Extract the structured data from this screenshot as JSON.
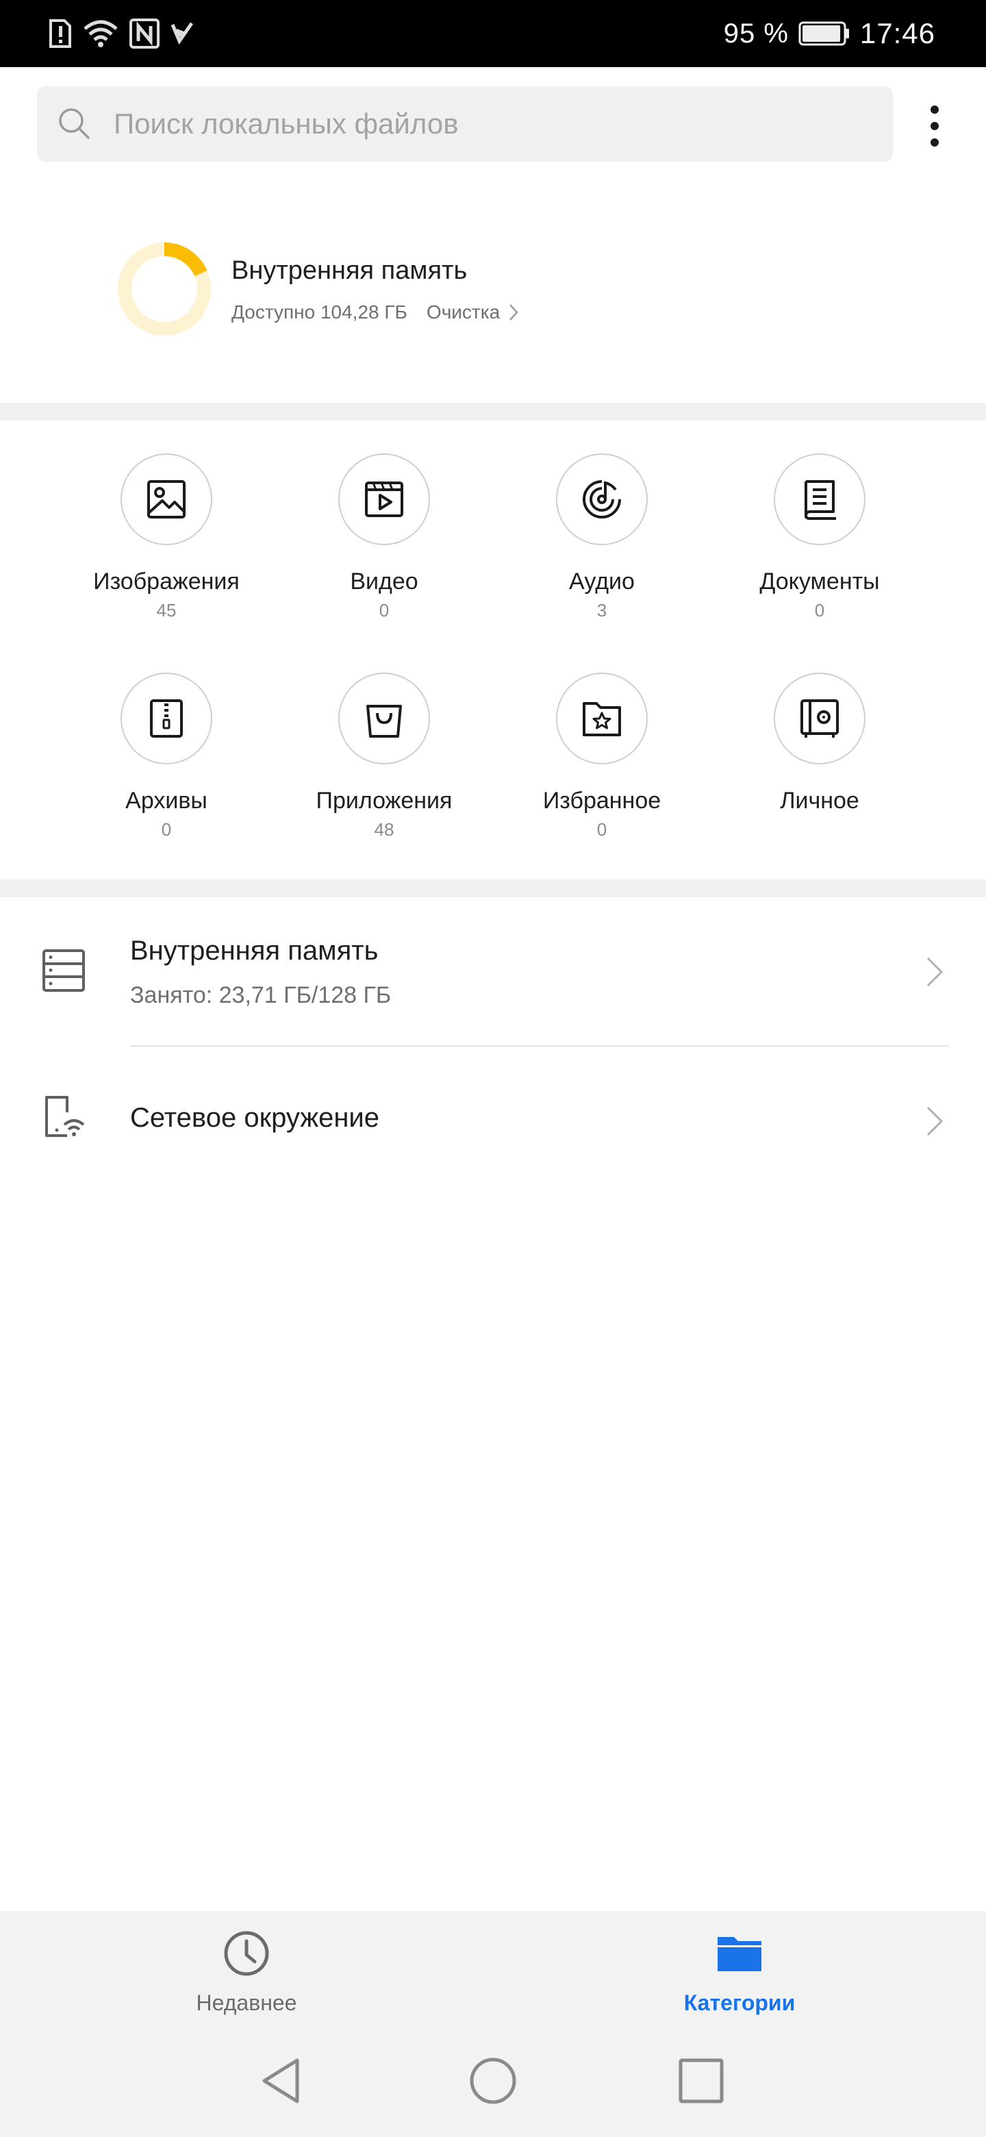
{
  "status_bar": {
    "battery_percent": "95 %",
    "time": "17:46",
    "battery_level": 0.95
  },
  "search": {
    "placeholder": "Поиск локальных файлов"
  },
  "storage_summary": {
    "title": "Внутренняя память",
    "available_text": "Доступно 104,28 ГБ",
    "clean_label": "Очистка",
    "used_fraction": 0.185,
    "accent_color": "#FBBC05",
    "track_color": "#FDF3D3"
  },
  "categories": [
    {
      "label": "Изображения",
      "count": "45",
      "icon": "image-icon"
    },
    {
      "label": "Видео",
      "count": "0",
      "icon": "video-icon"
    },
    {
      "label": "Аудио",
      "count": "3",
      "icon": "audio-icon"
    },
    {
      "label": "Документы",
      "count": "0",
      "icon": "document-icon"
    },
    {
      "label": "Архивы",
      "count": "0",
      "icon": "archive-icon"
    },
    {
      "label": "Приложения",
      "count": "48",
      "icon": "app-bag-icon"
    },
    {
      "label": "Избранное",
      "count": "0",
      "icon": "favorites-folder-icon"
    },
    {
      "label": "Личное",
      "count": "",
      "icon": "safe-icon"
    }
  ],
  "locations": [
    {
      "title": "Внутренняя память",
      "subtitle": "Занято: 23,71 ГБ/128 ГБ",
      "icon": "storage-icon"
    },
    {
      "title": "Сетевое окружение",
      "subtitle": "",
      "icon": "network-phone-icon"
    }
  ],
  "bottom_nav": {
    "tabs": [
      {
        "label": "Недавнее",
        "icon": "clock-icon",
        "active": false
      },
      {
        "label": "Категории",
        "icon": "folder-icon",
        "active": true
      }
    ],
    "active_color": "#1A73E8",
    "inactive_color": "#6b6b6b"
  }
}
